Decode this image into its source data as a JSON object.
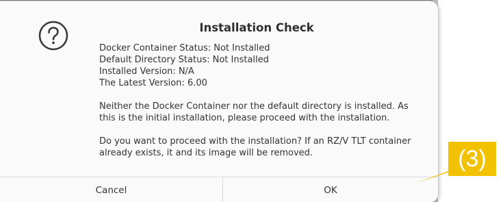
{
  "dialog": {
    "title": "Installation Check",
    "icon": "question-icon",
    "lines": {
      "docker_status": "Docker Container Status: Not Installed",
      "directory_status": "Default Directory Status: Not Installed",
      "installed_version": "Installed Version: N/A",
      "latest_version": "The Latest Version: 6.00",
      "message_1": "Neither the Docker Container nor the default directory is installed. As",
      "message_2": "this is the initial installation, please proceed with the installation.",
      "question_1": "Do you want to proceed with the installation? If an RZ/V TLT container",
      "question_2": "already exists, it and its image will be removed."
    },
    "buttons": {
      "cancel": "Cancel",
      "ok": "OK"
    }
  },
  "callout": {
    "label": "(3)",
    "color": "#f2c200"
  }
}
